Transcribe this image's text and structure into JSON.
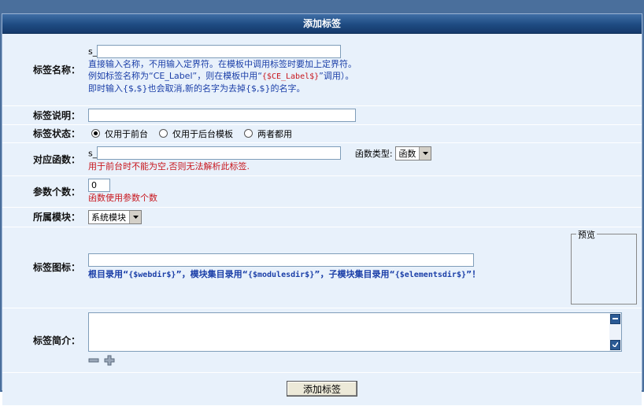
{
  "title": "添加标签",
  "fields": {
    "name": {
      "label": "标签名称：",
      "prefix": "s_",
      "value": "",
      "hint1": "直接输入名称，不用输入定界符。在模板中调用标签时要加上定界符。",
      "hint2_pre": "例如标签名称为“CE_Label”，则在模板中用“",
      "hint2_code": "{$CE_Label$}",
      "hint2_post": "”调用）。",
      "hint3": "即时输入{$,$}也会取消,新的名字为去掉{$,$}的名字。"
    },
    "desc": {
      "label": "标签说明：",
      "value": ""
    },
    "status": {
      "label": "标签状态：",
      "options": [
        "仅用于前台",
        "仅用于后台模板",
        "两者都用"
      ],
      "selected_index": 0
    },
    "func": {
      "label": "对应函数：",
      "prefix": "s_",
      "value": "",
      "type_label": "函数类型:",
      "type_value": "函数",
      "hint": "用于前台时不能为空,否则无法解析此标签."
    },
    "params": {
      "label": "参数个数：",
      "value": "0",
      "hint": "函数使用参数个数"
    },
    "module": {
      "label": "所属模块：",
      "value": "系统模块"
    },
    "icon": {
      "label": "标签图标：",
      "value": "",
      "hint_a": "根目录用“",
      "code_a": "{$webdir$}",
      "hint_b": "”，模块集目录用“",
      "code_b": "{$modulesdir$}",
      "hint_c": "”，子模块集目录用“",
      "code_c": "{$elementsdir$}",
      "hint_d": "”！",
      "preview_legend": "预览"
    },
    "intro": {
      "label": "标签简介：",
      "value": ""
    }
  },
  "submit_label": "添加标签",
  "colors": {
    "frame": "#4a6f9c",
    "row": "#e8f1fb",
    "hint_blue": "#1b3fa8",
    "hint_red": "#c8161d",
    "title_bar": "#1e4b82"
  }
}
